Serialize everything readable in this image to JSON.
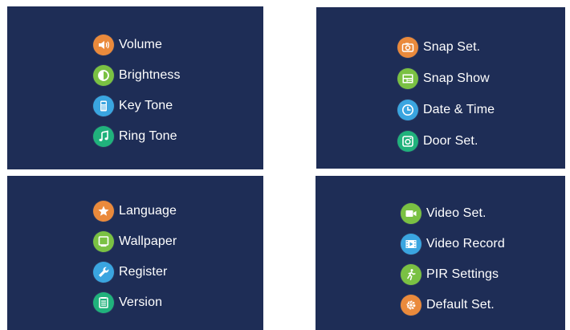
{
  "colors": {
    "panel_bg": "#1e2d56",
    "text": "#ffffff",
    "orange": "#ea8a3c",
    "green": "#7ac143",
    "blue": "#3aa5e0",
    "teal": "#20b27c"
  },
  "panels": [
    {
      "items": [
        {
          "label": "Volume",
          "icon": "speaker-icon",
          "color": "#ea8a3c"
        },
        {
          "label": "Brightness",
          "icon": "brightness-icon",
          "color": "#7ac143"
        },
        {
          "label": "Key Tone",
          "icon": "keypad-icon",
          "color": "#3aa5e0"
        },
        {
          "label": "Ring Tone",
          "icon": "music-note-icon",
          "color": "#20b27c"
        }
      ]
    },
    {
      "items": [
        {
          "label": "Snap Set.",
          "icon": "camera-icon",
          "color": "#ea8a3c"
        },
        {
          "label": "Snap Show",
          "icon": "slideshow-icon",
          "color": "#7ac143"
        },
        {
          "label": "Date & Time",
          "icon": "clock-icon",
          "color": "#3aa5e0"
        },
        {
          "label": "Door Set.",
          "icon": "door-camera-icon",
          "color": "#20b27c"
        }
      ]
    },
    {
      "items": [
        {
          "label": "Language",
          "icon": "star-icon",
          "color": "#ea8a3c"
        },
        {
          "label": "Wallpaper",
          "icon": "monitor-icon",
          "color": "#7ac143"
        },
        {
          "label": "Register",
          "icon": "wrench-icon",
          "color": "#3aa5e0"
        },
        {
          "label": "Version",
          "icon": "document-icon",
          "color": "#20b27c"
        }
      ]
    },
    {
      "items": [
        {
          "label": "Video Set.",
          "icon": "video-camera-icon",
          "color": "#7ac143"
        },
        {
          "label": "Video Record",
          "icon": "film-icon",
          "color": "#3aa5e0"
        },
        {
          "label": "PIR Settings",
          "icon": "motion-sensor-icon",
          "color": "#7ac143"
        },
        {
          "label": "Default Set.",
          "icon": "gear-icon",
          "color": "#ea8a3c"
        }
      ]
    }
  ]
}
